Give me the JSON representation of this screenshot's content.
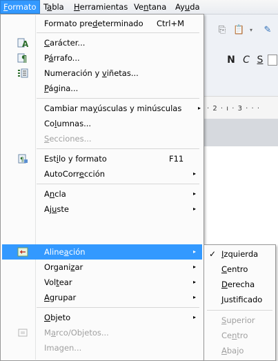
{
  "menubar": {
    "items": [
      {
        "label": "Formato",
        "mnemonic": "F",
        "rest": "ormato"
      },
      {
        "label": "Tabla",
        "mnemonic": "a",
        "pre": "T",
        "rest": "bla"
      },
      {
        "label": "Herramientas",
        "mnemonic": "H",
        "rest": "erramientas"
      },
      {
        "label": "Ventana",
        "pre": "Ve",
        "mnemonic": "n",
        "rest": "tana"
      },
      {
        "label": "Ayuda",
        "pre": "Ay",
        "mnemonic": "u",
        "rest": "da"
      }
    ]
  },
  "background": {
    "ruler_text": "· 2 · ı · 3 · · ·",
    "format_buttons": [
      "N",
      "C",
      "S"
    ]
  },
  "format_menu": {
    "items": [
      {
        "pre": "Formato pre",
        "u": "d",
        "post": "eterminado",
        "shortcut": "Ctrl+M"
      },
      {
        "pre": "",
        "u": "C",
        "post": "arácter..."
      },
      {
        "pre": "P",
        "u": "á",
        "post": "rrafo..."
      },
      {
        "pre": "Numeración y ",
        "u": "v",
        "post": "iñetas..."
      },
      {
        "pre": "",
        "u": "P",
        "post": "ágina..."
      },
      {
        "pre": "Cambiar ma",
        "u": "y",
        "post": "úsculas y minúsculas"
      },
      {
        "pre": "Co",
        "u": "l",
        "post": "umnas..."
      },
      {
        "pre": "",
        "u": "S",
        "post": "ecciones..."
      },
      {
        "pre": "Est",
        "u": "i",
        "post": "lo y formato",
        "shortcut": "F11"
      },
      {
        "pre": "AutoCorr",
        "u": "e",
        "post": "cción"
      },
      {
        "pre": "A",
        "u": "n",
        "post": "cla"
      },
      {
        "pre": "Aj",
        "u": "u",
        "post": "ste"
      },
      {
        "pre": "Aline",
        "u": "a",
        "post": "ción"
      },
      {
        "pre": "Organi",
        "u": "z",
        "post": "ar"
      },
      {
        "pre": "Vol",
        "u": "t",
        "post": "ear"
      },
      {
        "pre": "",
        "u": "A",
        "post": "grupar"
      },
      {
        "pre": "",
        "u": "O",
        "post": "bjeto"
      },
      {
        "pre": "M",
        "u": "a",
        "post": "rco/Objetos..."
      },
      {
        "pre": "Imagen...",
        "u": "",
        "post": ""
      }
    ]
  },
  "align_submenu": {
    "items": [
      {
        "u": "I",
        "post": "zquierda",
        "checked": "✓"
      },
      {
        "u": "C",
        "post": "entro"
      },
      {
        "u": "D",
        "post": "erecha"
      },
      {
        "u": "J",
        "post": "ustificado"
      },
      {
        "u": "S",
        "post": "uperior"
      },
      {
        "pre": "Ce",
        "u": "n",
        "post": "tro"
      },
      {
        "u": "A",
        "post": "bajo"
      }
    ]
  },
  "colors": {
    "highlight": "#3399ff",
    "menu_bg": "#fbfbfb",
    "disabled_text": "#a0a0a0"
  }
}
